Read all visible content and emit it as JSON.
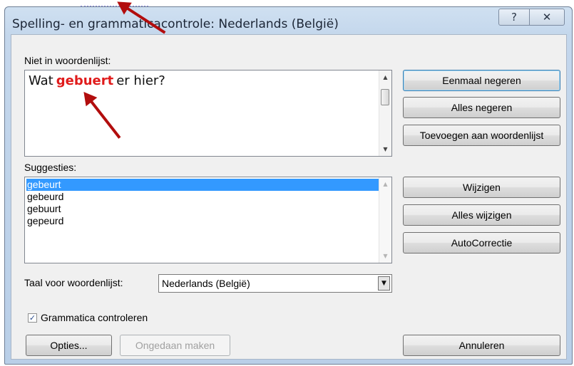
{
  "window": {
    "title": "Spelling- en grammaticacontrole: Nederlands (België)",
    "help_icon": "?",
    "close_icon": "✕"
  },
  "not_in_dictionary": {
    "label_prefix": "Niet in woordenlijst:",
    "sentence_before": "Wat",
    "error_word": "gebuert",
    "sentence_after": "er hier?"
  },
  "suggestions": {
    "label": "Suggesties:",
    "items": [
      "gebeurt",
      "gebeurd",
      "gebuurt",
      "gepeurd"
    ],
    "selected_index": 0
  },
  "language": {
    "label": "Taal voor woordenlijst:",
    "value": "Nederlands (België)"
  },
  "grammar_check": {
    "label": "Grammatica controleren",
    "checked": true
  },
  "buttons": {
    "ignore_once": "Eenmaal negeren",
    "ignore_all": "Alles negeren",
    "add_to_dictionary": "Toevoegen aan woordenlijst",
    "change": "Wijzigen",
    "change_all": "Alles wijzigen",
    "autocorrect": "AutoCorrectie",
    "options": "Opties...",
    "undo": "Ongedaan maken",
    "cancel": "Annuleren"
  },
  "colors": {
    "error_text": "#e01b1b",
    "annotation_arrow": "#b20d0d",
    "selection": "#3399ff"
  }
}
